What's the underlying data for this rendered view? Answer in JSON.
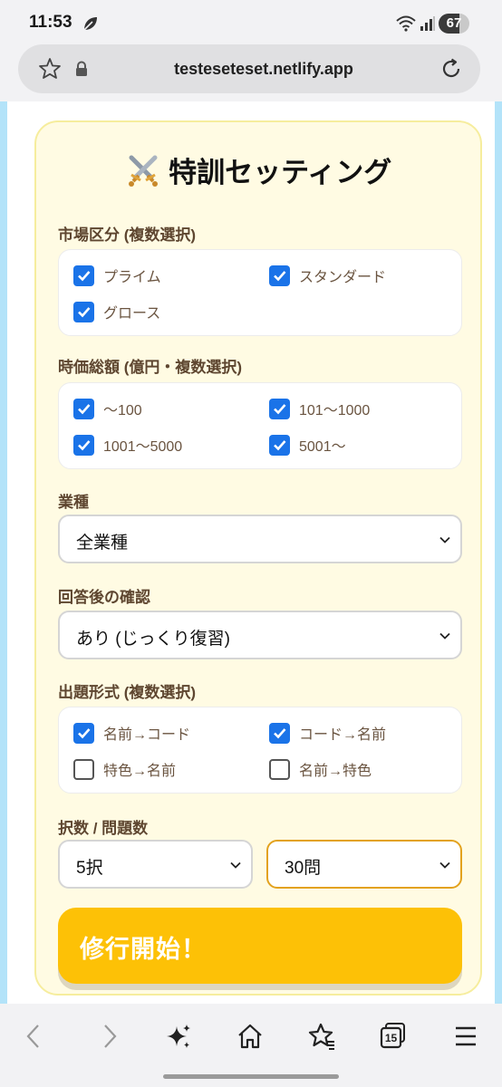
{
  "status": {
    "time": "11:53",
    "battery": "67",
    "battery_level": 0.67
  },
  "browser": {
    "url": "testeseteset.netlify.app",
    "tab_count": "15"
  },
  "page": {
    "title": "特訓セッティング",
    "market": {
      "label": "市場区分 (複数選択)",
      "options": [
        {
          "label": "プライム",
          "checked": true
        },
        {
          "label": "スタンダード",
          "checked": true
        },
        {
          "label": "グロース",
          "checked": true
        }
      ]
    },
    "cap": {
      "label": "時価総額 (億円・複数選択)",
      "options": [
        {
          "label": "〜100",
          "checked": true
        },
        {
          "label": "101〜1000",
          "checked": true
        },
        {
          "label": "1001〜5000",
          "checked": true
        },
        {
          "label": "5001〜",
          "checked": true
        }
      ]
    },
    "industry": {
      "label": "業種",
      "value": "全業種"
    },
    "review": {
      "label": "回答後の確認",
      "value": "あり (じっくり復習)"
    },
    "format": {
      "label": "出題形式 (複数選択)",
      "options": [
        {
          "label": "名前→コード",
          "checked": true
        },
        {
          "label": "コード→名前",
          "checked": true
        },
        {
          "label": "特色→名前",
          "checked": false
        },
        {
          "label": "名前→特色",
          "checked": false
        }
      ]
    },
    "counts": {
      "label": "択数 / 問題数",
      "choices": "5択",
      "questions": "30問"
    },
    "start_button": "修行開始！"
  },
  "colors": {
    "accent": "#fdc106",
    "checkbox": "#1a73e8",
    "label": "#5e4630",
    "card_bg": "#fffbe3",
    "card_border": "#f6ed9d",
    "side_bg": "#b3e3f9"
  }
}
